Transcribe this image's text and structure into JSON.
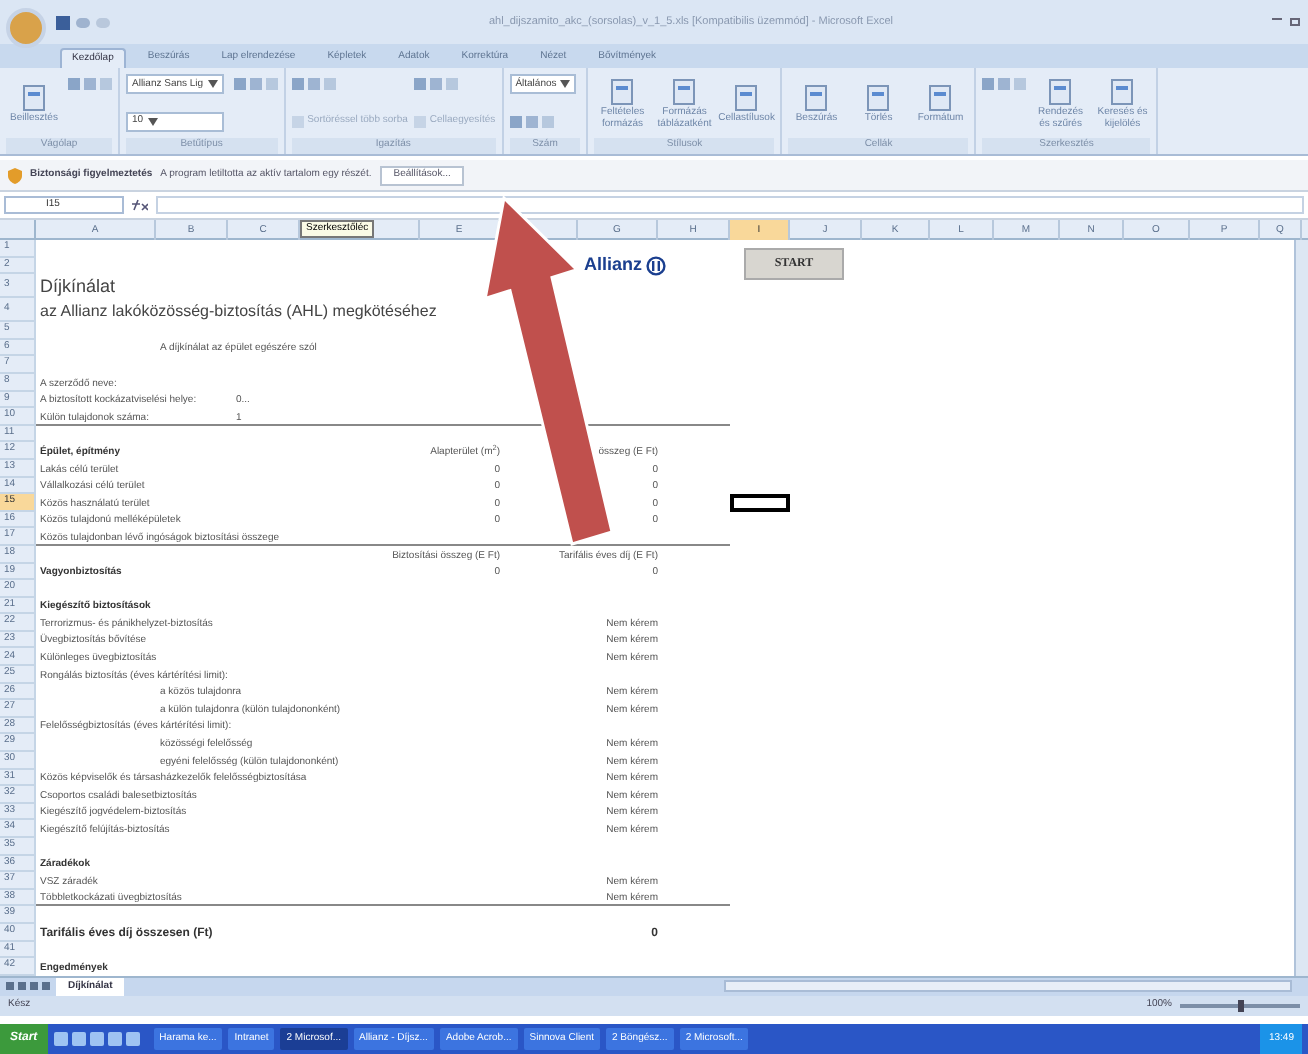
{
  "window": {
    "title": "ahl_dijszamito_akc_(sorsolas)_v_1_5.xls [Kompatibilis üzemmód] - Microsoft Excel"
  },
  "ribbon_tabs": [
    {
      "label": "Kezdőlap",
      "selected": true
    },
    {
      "label": "Beszúrás",
      "selected": false
    },
    {
      "label": "Lap elrendezése",
      "selected": false
    },
    {
      "label": "Képletek",
      "selected": false
    },
    {
      "label": "Adatok",
      "selected": false
    },
    {
      "label": "Korrektúra",
      "selected": false
    },
    {
      "label": "Nézet",
      "selected": false
    },
    {
      "label": "Bővítmények",
      "selected": false
    }
  ],
  "ribbon_groups": [
    {
      "label": "Vágólap",
      "items": [
        {
          "kind": "big",
          "label": "Beillesztés"
        },
        {
          "kind": "tools"
        }
      ]
    },
    {
      "label": "Betűtípus",
      "items": [
        {
          "kind": "field",
          "label": "Allianz Sans Lig"
        },
        {
          "kind": "field",
          "label": "10"
        },
        {
          "kind": "tools"
        }
      ]
    },
    {
      "label": "Igazítás",
      "items": [
        {
          "kind": "tools"
        },
        {
          "kind": "small",
          "label": "Sortöréssel több sorba"
        },
        {
          "kind": "tools"
        },
        {
          "kind": "small",
          "label": "Cellaegyesítés"
        }
      ]
    },
    {
      "label": "Szám",
      "items": [
        {
          "kind": "field",
          "label": "Általános"
        },
        {
          "kind": "tools"
        }
      ]
    },
    {
      "label": "Stílusok",
      "items": [
        {
          "kind": "big",
          "label": "Feltételes formázás"
        },
        {
          "kind": "big",
          "label": "Formázás táblázatként"
        },
        {
          "kind": "big",
          "label": "Cellastílusok"
        }
      ]
    },
    {
      "label": "Cellák",
      "items": [
        {
          "kind": "big",
          "label": "Beszúrás"
        },
        {
          "kind": "big",
          "label": "Törlés"
        },
        {
          "kind": "big",
          "label": "Formátum"
        }
      ]
    },
    {
      "label": "Szerkesztés",
      "items": [
        {
          "kind": "tools"
        },
        {
          "kind": "big",
          "label": "Rendezés és szűrés"
        },
        {
          "kind": "big",
          "label": "Keresés és kijelölés"
        }
      ]
    }
  ],
  "security_bar": {
    "title": "Biztonsági figyelmeztetés",
    "message": "A program letiltotta az aktív tartalom egy részét.",
    "button": "Beállítások..."
  },
  "formula_bar": {
    "name_box": "I15",
    "tooltip": "Szerkesztőléc"
  },
  "columns": [
    {
      "label": "A",
      "selected": false
    },
    {
      "label": "B",
      "selected": false
    },
    {
      "label": "C",
      "selected": false
    },
    {
      "selected": false
    },
    {
      "label": "E",
      "selected": false
    },
    {
      "selected": false
    },
    {
      "label": "G",
      "selected": false
    },
    {
      "label": "H",
      "selected": false
    },
    {
      "label": "I",
      "selected": true
    },
    {
      "label": "J",
      "selected": false
    },
    {
      "label": "K",
      "selected": false
    },
    {
      "label": "L",
      "selected": false
    },
    {
      "label": "M",
      "selected": false
    },
    {
      "label": "N",
      "selected": false
    },
    {
      "label": "O",
      "selected": false
    },
    {
      "label": "P",
      "selected": false
    },
    {
      "label": "Q",
      "selected": false
    }
  ],
  "logo": {
    "text": "Allianz"
  },
  "start_button": {
    "label": "START"
  },
  "rows": [
    {
      "number": "1",
      "selected": false,
      "rule": false
    },
    {
      "number": "2",
      "selected": false,
      "rule": false
    },
    {
      "number": "3",
      "selected": false,
      "rule": false,
      "kind": "title",
      "label": "Díjkínálat"
    },
    {
      "number": "4",
      "selected": false,
      "rule": false,
      "kind": "subtitle",
      "label": "az Allianz lakóközösség-biztosítás (AHL) megkötéséhez"
    },
    {
      "number": "5",
      "selected": false,
      "rule": false
    },
    {
      "number": "6",
      "selected": false,
      "rule": false,
      "kind": "note",
      "label": "A díjkínálat az épület egészére szól"
    },
    {
      "number": "7",
      "selected": false,
      "rule": false
    },
    {
      "number": "8",
      "selected": false,
      "rule": false,
      "kind": "text",
      "label": "A szerződő neve:"
    },
    {
      "number": "9",
      "selected": false,
      "rule": false,
      "kind": "text",
      "label": "A biztosított kockázatviselési helye:",
      "column_b": "0..."
    },
    {
      "number": "10",
      "selected": false,
      "rule": true,
      "kind": "text",
      "label": "Külön tulajdonok száma:",
      "column_b": "1"
    },
    {
      "number": "11",
      "selected": false,
      "rule": false
    },
    {
      "number": "12",
      "selected": false,
      "rule": false,
      "kind": "heading",
      "label": "Épület, építmény",
      "column_e": "Alapterület (m$^{2}$)",
      "column_g": "összeg (E Ft)"
    },
    {
      "number": "13",
      "selected": false,
      "rule": false,
      "kind": "text",
      "label": "Lakás célú terület",
      "column_e": "0",
      "column_g": "0"
    },
    {
      "number": "14",
      "selected": false,
      "rule": false,
      "kind": "text",
      "label": "Vállalkozási célú terület",
      "column_e": "0",
      "column_g": "0"
    },
    {
      "number": "15",
      "selected": true,
      "rule": false,
      "kind": "text",
      "label": "Közös használatú terület",
      "column_e": "0",
      "column_g": "0"
    },
    {
      "number": "16",
      "selected": false,
      "rule": false,
      "kind": "text",
      "label": "Közös tulajdonú melléképületek",
      "column_e": "0",
      "column_g": "0"
    },
    {
      "number": "17",
      "selected": false,
      "rule": true,
      "kind": "text",
      "label": "Közös tulajdonban lévő ingóságok biztosítási összege"
    },
    {
      "number": "18",
      "selected": false,
      "rule": false,
      "column_e": "Biztosítási összeg (E Ft)",
      "column_g": "Tarifális éves díj (E Ft)"
    },
    {
      "number": "19",
      "selected": false,
      "rule": false,
      "kind": "heading",
      "label": "Vagyonbiztosítás",
      "column_e": "0",
      "column_g": "0"
    },
    {
      "number": "20",
      "selected": false,
      "rule": false
    },
    {
      "number": "21",
      "selected": false,
      "rule": false,
      "kind": "heading",
      "label": "Kiegészítő biztosítások"
    },
    {
      "number": "22",
      "selected": false,
      "rule": false,
      "kind": "text",
      "label": "Terrorizmus- és pánikhelyzet-biztosítás",
      "column_g": "Nem kérem"
    },
    {
      "number": "23",
      "selected": false,
      "rule": false,
      "kind": "text",
      "label": "Üvegbiztosítás bővítése",
      "column_g": "Nem kérem"
    },
    {
      "number": "24",
      "selected": false,
      "rule": false,
      "kind": "text",
      "label": "Különleges üvegbiztosítás",
      "column_g": "Nem kérem"
    },
    {
      "number": "25",
      "selected": false,
      "rule": false,
      "kind": "text",
      "label": "Rongálás biztosítás (éves kártérítési limit):"
    },
    {
      "number": "26",
      "selected": false,
      "rule": false,
      "kind": "indent",
      "label": "a közös tulajdonra",
      "column_g": "Nem kérem"
    },
    {
      "number": "27",
      "selected": false,
      "rule": false,
      "kind": "indent",
      "label": "a külön tulajdonra (külön tulajdononként)",
      "column_g": "Nem kérem"
    },
    {
      "number": "28",
      "selected": false,
      "rule": false,
      "kind": "text",
      "label": "Felelősségbiztosítás (éves kártérítési limit):"
    },
    {
      "number": "29",
      "selected": false,
      "rule": false,
      "kind": "indent",
      "label": "közösségi felelősség",
      "column_g": "Nem kérem"
    },
    {
      "number": "30",
      "selected": false,
      "rule": false,
      "kind": "indent",
      "label": "egyéni felelősség (külön tulajdononként)",
      "column_g": "Nem kérem"
    },
    {
      "number": "31",
      "selected": false,
      "rule": false,
      "kind": "text",
      "label": "Közös képviselők és társasházkezelők felelősségbiztosítása",
      "column_g": "Nem kérem"
    },
    {
      "number": "32",
      "selected": false,
      "rule": false,
      "kind": "text",
      "label": "Csoportos családi balesetbiztosítás",
      "column_g": "Nem kérem"
    },
    {
      "number": "33",
      "selected": false,
      "rule": false,
      "kind": "text",
      "label": "Kiegészítő jogvédelem-biztosítás",
      "column_g": "Nem kérem"
    },
    {
      "number": "34",
      "selected": false,
      "rule": false,
      "kind": "text",
      "label": "Kiegészítő felújítás-biztosítás",
      "column_g": "Nem kérem"
    },
    {
      "number": "35",
      "selected": false,
      "rule": false
    },
    {
      "number": "36",
      "selected": false,
      "rule": false,
      "kind": "heading",
      "label": "Záradékok"
    },
    {
      "number": "37",
      "selected": false,
      "rule": false,
      "kind": "text",
      "label": "VSZ záradék",
      "column_g": "Nem kérem"
    },
    {
      "number": "38",
      "selected": false,
      "rule": true,
      "kind": "text",
      "label": "Többletkockázati üvegbiztosítás",
      "column_g": "Nem kérem"
    },
    {
      "number": "39",
      "selected": false,
      "rule": false
    },
    {
      "number": "40",
      "selected": false,
      "rule": false,
      "kind": "total",
      "label": "Tarifális éves díj összesen (Ft)",
      "column_g": "0"
    },
    {
      "number": "41",
      "selected": false,
      "rule": false
    },
    {
      "number": "42",
      "selected": false,
      "rule": false,
      "kind": "heading",
      "label": "Engedmények"
    }
  ],
  "sheet_tabs": [
    {
      "label": "Díjkínálat",
      "selected": true
    }
  ],
  "status_bar": {
    "text": "Kész",
    "zoom": "100%",
    "zoom_slider": {
      "level": 0.5
    }
  },
  "taskbar": {
    "start": "Start",
    "items": [
      {
        "label": "Harama ke...",
        "selected": false
      },
      {
        "label": "Intranet",
        "selected": false
      },
      {
        "label": "2 Microsof...",
        "selected": true
      },
      {
        "label": "Allianz - Díjsz...",
        "selected": false
      },
      {
        "label": "Adobe Acrob...",
        "selected": false
      },
      {
        "label": "Sinnova Client",
        "selected": false
      },
      {
        "label": "2 Böngész...",
        "selected": false
      },
      {
        "label": "2 Microsoft...",
        "selected": false
      }
    ],
    "clock": "13:49"
  }
}
